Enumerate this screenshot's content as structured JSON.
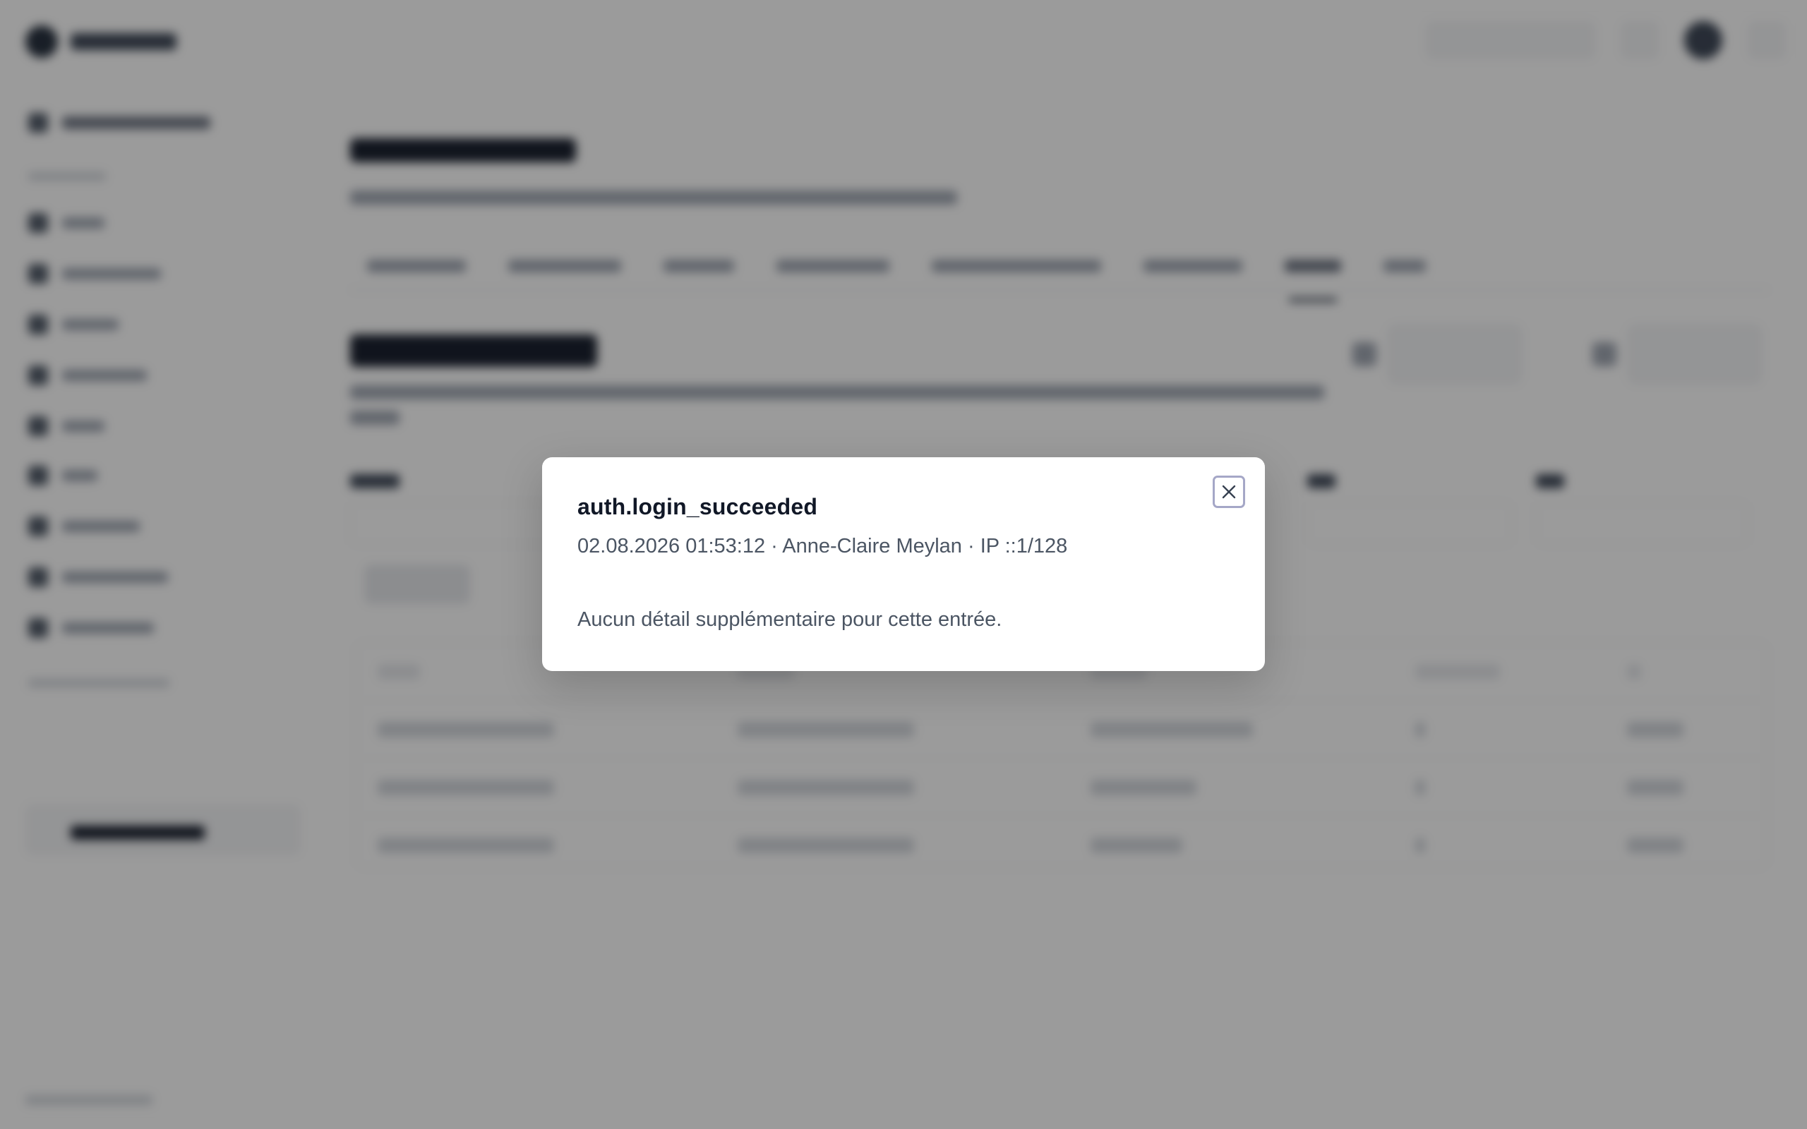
{
  "modal": {
    "title": "auth.login_succeeded",
    "meta": "02.08.2026 01:53:12 · Anne-Claire Meylan · IP ::1/128",
    "body": "Aucun détail supplémentaire pour cette entrée.",
    "close_icon": "close-icon"
  },
  "colors": {
    "backdrop": "#8f8f8f",
    "modal_bg": "#ffffff",
    "title_text": "#111827",
    "body_text": "#4b5563",
    "close_border": "#a5a7c7"
  }
}
